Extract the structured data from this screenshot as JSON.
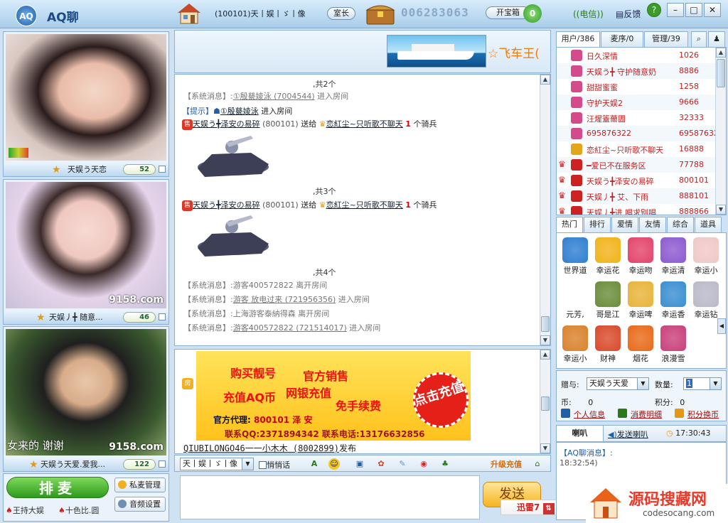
{
  "app": {
    "logo": "AQ",
    "title": "AQ聊"
  },
  "header": {
    "room_name": "(100101)天丨娱丨ゞ丨像",
    "host_btn": "室长",
    "room_number": "006283063",
    "chest_btn": "开宝箱",
    "chest_count": "0",
    "telecom": "电信",
    "feedback": "反馈"
  },
  "videos": [
    {
      "name": "天娱う天恋",
      "count": "52"
    },
    {
      "name": "天娱丿╋ 随意...",
      "count": "46",
      "watermark": "9158.com"
    },
    {
      "name": "天娱う天爱.爱我...",
      "count": "122",
      "watermark": "9158.com",
      "caption": "女来的 谢谢"
    }
  ],
  "left_controls": {
    "mic_btn": "排麦",
    "private_mic": "私麦管理",
    "audio_settings": "音频设置",
    "host1": "王持大娱",
    "host2": "十色比.圆"
  },
  "banner": {
    "text": "☆飞车王("
  },
  "chat": {
    "total_2": ",共2个",
    "sys1_label": "【系统消息】:",
    "sys1_user": "①殷甆婈泳 (7004544)",
    "sys1_action": "进入房间",
    "tip_label": "【提示】",
    "tip_user": "①殷甆婈泳",
    "tip_action": "进入房间",
    "gift1_sender": "天娱う╋泽安の易碎",
    "gift1_id": "(800101)",
    "gift1_verb": "送给",
    "gift1_receiver": "恋紅尘~只听歌不聊天",
    "gift1_qty": "1",
    "gift1_unit": "个骑兵",
    "total_3": ",共3个",
    "gift2_sender": "天娱う╋泽安の易碎",
    "gift2_id": "(800101)",
    "gift2_verb": "送给",
    "gift2_receiver": "恋紅尘~只听歌不聊天",
    "gift2_qty": "1",
    "gift2_unit": "个骑兵",
    "total_4": ",共4个",
    "sys2_label": "【系统消息】:",
    "sys2_text": "游客400572822  离开房间",
    "sys3_label": "【系统消息】:",
    "sys3_user": "游客 放电过来 (721956356)",
    "sys3_action": "进入房间",
    "sys4_label": "【系统消息】:",
    "sys4_text": "上海游客泰納得森  离开房间",
    "sys5_label": "【系统消息】:",
    "sys5_user": "游客400572822 (721514017)",
    "sys5_action": "进入房间"
  },
  "ad": {
    "l1": "购买靓号",
    "l2": "官方销售",
    "l3": "充值AQ币",
    "l4": "网银充值",
    "l5": "免手续费",
    "agent": "官方代理:",
    "agent_id": "800101",
    "agent_name": "泽 安",
    "contact": "联系QQ:2371894342  联系电话:13176632856",
    "stamp": "点击充值",
    "footer_user": "QIUBILONGO46一一小木木 (8002899)",
    "footer_action": "发布"
  },
  "toolbar": {
    "font": "天丨娱丨ゞ丨像",
    "whisper": "悄悄话",
    "upgrade": "升级充值"
  },
  "send": {
    "label": "发送",
    "thunder": "迅雷7"
  },
  "user_tabs": [
    "用户/386",
    "麦序/0",
    "管理/39"
  ],
  "users": [
    {
      "name": "日久深情",
      "id": "1026"
    },
    {
      "name": "天娱う╋ 守护随意奶",
      "id": "8886"
    },
    {
      "name": "甜甜蜜蜜",
      "id": "1258"
    },
    {
      "name": "守护天娱2",
      "id": "9666"
    },
    {
      "name": "汪煋篕薾圕",
      "id": "32333"
    },
    {
      "name": "695876322",
      "id": "69587632"
    },
    {
      "name": "恋紅尘~只听歌不聊天",
      "id": "16888"
    },
    {
      "name": "━爱已不在服务区",
      "id": "77788"
    },
    {
      "name": "天娱う╋泽安の易碎",
      "id": "800101"
    },
    {
      "name": "天娱丿╋ 艾、下雨",
      "id": "888101"
    },
    {
      "name": "天娱丿╋进 唱求别唱",
      "id": "888866"
    }
  ],
  "gift_tabs": [
    "热门",
    "排行",
    "爱情",
    "友情",
    "综合",
    "道具"
  ],
  "gifts": [
    "世界道",
    "幸运花",
    "幸运吻",
    "幸运清",
    "幸运小",
    "元芳,",
    "哥是江",
    "幸运啤",
    "幸运香",
    "幸运钻",
    "幸运小",
    "财神",
    "烟花",
    "浪漫雪"
  ],
  "gift_form": {
    "give_to_label": "赠与:",
    "give_to": "天娱う天爱",
    "qty_label": "数量:",
    "qty": "1",
    "coin_label": "币:",
    "coin": "0",
    "points_label": "积分:",
    "points": "0",
    "profile": "个人信息",
    "spending": "消费明细",
    "exchange": "积分换币"
  },
  "horn": {
    "tab1": "喇叭",
    "tab2": "发送喇叭",
    "time": "17:30:43",
    "msg_title": "【AQ聊消息】:",
    "msg_time": "18:32:54)"
  },
  "watermark": {
    "cn": "源码搜藏网",
    "en": "codesocang.com"
  },
  "colors": {
    "accent": "#1c4a86",
    "user_red": "#c02020",
    "ad_yellow": "#ffc21c",
    "mic_green": "#2d9a1c"
  }
}
